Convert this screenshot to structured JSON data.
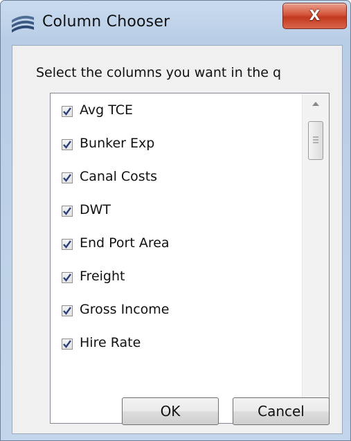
{
  "window": {
    "title": "Column Chooser",
    "close_label": "X"
  },
  "dialog": {
    "instruction": "Select the columns you want in the q",
    "columns": [
      {
        "label": "Avg TCE",
        "checked": true
      },
      {
        "label": "Bunker Exp",
        "checked": true
      },
      {
        "label": "Canal Costs",
        "checked": true
      },
      {
        "label": "DWT",
        "checked": true
      },
      {
        "label": "End Port Area",
        "checked": true
      },
      {
        "label": "Freight",
        "checked": true
      },
      {
        "label": "Gross Income",
        "checked": true
      },
      {
        "label": "Hire Rate",
        "checked": true
      }
    ],
    "ok_label": "OK",
    "cancel_label": "Cancel"
  },
  "colors": {
    "checkmark": "#2a3f7a",
    "close_button": "#c2391f"
  }
}
